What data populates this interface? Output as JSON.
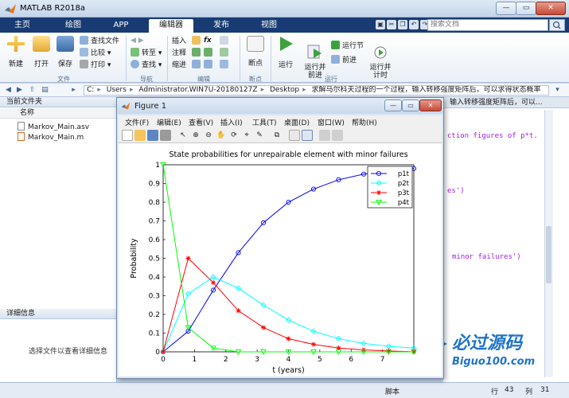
{
  "app": {
    "title": "MATLAB R2018a"
  },
  "window_controls": {
    "minimize": "—",
    "maximize": "▭",
    "close": "✕"
  },
  "tabs": [
    "主页",
    "绘图",
    "APP",
    "编辑器",
    "发布",
    "视图"
  ],
  "search_docs": {
    "placeholder": "搜索文档"
  },
  "ribbon": {
    "file_group": {
      "new": "新建",
      "open": "打开",
      "save": "保存",
      "find_files": "查找文件",
      "compare": "比较",
      "print": "打印",
      "label": "文件"
    },
    "nav_group": {
      "goto": "转至",
      "find": "查找",
      "label": "导航"
    },
    "edit_group": {
      "insert": "插入",
      "comment": "注释",
      "indent": "缩进",
      "fx": "fx",
      "label": "编辑"
    },
    "breakpoint_group": {
      "breakpoints": "断点",
      "label": "断点"
    },
    "run_group": {
      "run": "运行",
      "run_advance": "运行并\n前进",
      "run_section": "运行节",
      "advance": "前进",
      "run_time": "运行并\n计时",
      "label": "运行"
    }
  },
  "address": {
    "crumbs": [
      "C:",
      "Users",
      "Administrator.WIN7U-20180127Z",
      "Desktop",
      "求解马尔科夫过程的一个过程，输入转移强度矩阵后，可以求得状态概率"
    ]
  },
  "current_folder": {
    "title": "当前文件夹",
    "column": "名称",
    "files": [
      "Markov_Main.asv",
      "Markov_Main.m"
    ]
  },
  "details": {
    "title": "详细信息",
    "hint": "选择文件以查看详细信息"
  },
  "editor": {
    "tab_text": "输入转移强度矩阵后，可以...",
    "code_fragments": [
      "ction figures of p*t.",
      "es')",
      "minor failures')"
    ]
  },
  "status": {
    "script": "脚本",
    "row_label": "行",
    "row": "43",
    "col_label": "列",
    "col": "31"
  },
  "watermark": {
    "brand": "必过源码",
    "url": "Biguo100.com"
  },
  "figure": {
    "title": "Figure 1",
    "menus": [
      "文件(F)",
      "编辑(E)",
      "查看(V)",
      "插入(I)",
      "工具(T)",
      "桌面(D)",
      "窗口(W)",
      "帮助(H)"
    ]
  },
  "chart_data": {
    "type": "line",
    "title": "State probabilities for unrepairable element with minor failures",
    "xlabel": "t (years)",
    "ylabel": "Probability",
    "xlim": [
      0,
      8
    ],
    "ylim": [
      0,
      1
    ],
    "xticks": [
      0,
      1,
      2,
      3,
      4,
      5,
      6,
      7
    ],
    "yticks": [
      0,
      0.1,
      0.2,
      0.3,
      0.4,
      0.5,
      0.6,
      0.7,
      0.8,
      0.9,
      1
    ],
    "legend_position": "top-right",
    "x": [
      0,
      0.8,
      1.6,
      2.4,
      3.2,
      4.0,
      4.8,
      5.6,
      6.4,
      7.2,
      8.0
    ],
    "series": [
      {
        "name": "p1t",
        "color": "#0000ff",
        "marker": "circle",
        "values": [
          0.0,
          0.11,
          0.33,
          0.53,
          0.69,
          0.8,
          0.87,
          0.92,
          0.95,
          0.97,
          0.98
        ]
      },
      {
        "name": "p2t",
        "color": "#00ffff",
        "marker": "diamond",
        "values": [
          0.0,
          0.31,
          0.4,
          0.34,
          0.25,
          0.17,
          0.11,
          0.07,
          0.045,
          0.03,
          0.02
        ]
      },
      {
        "name": "p3t",
        "color": "#ff0000",
        "marker": "star",
        "values": [
          0.0,
          0.5,
          0.37,
          0.22,
          0.13,
          0.07,
          0.04,
          0.02,
          0.01,
          0.005,
          0.0
        ]
      },
      {
        "name": "p4t",
        "color": "#00ff00",
        "marker": "triangle-down",
        "values": [
          1.0,
          0.13,
          0.02,
          0.0,
          0.0,
          0.0,
          0.0,
          0.0,
          0.0,
          0.0,
          0.0
        ]
      }
    ]
  }
}
